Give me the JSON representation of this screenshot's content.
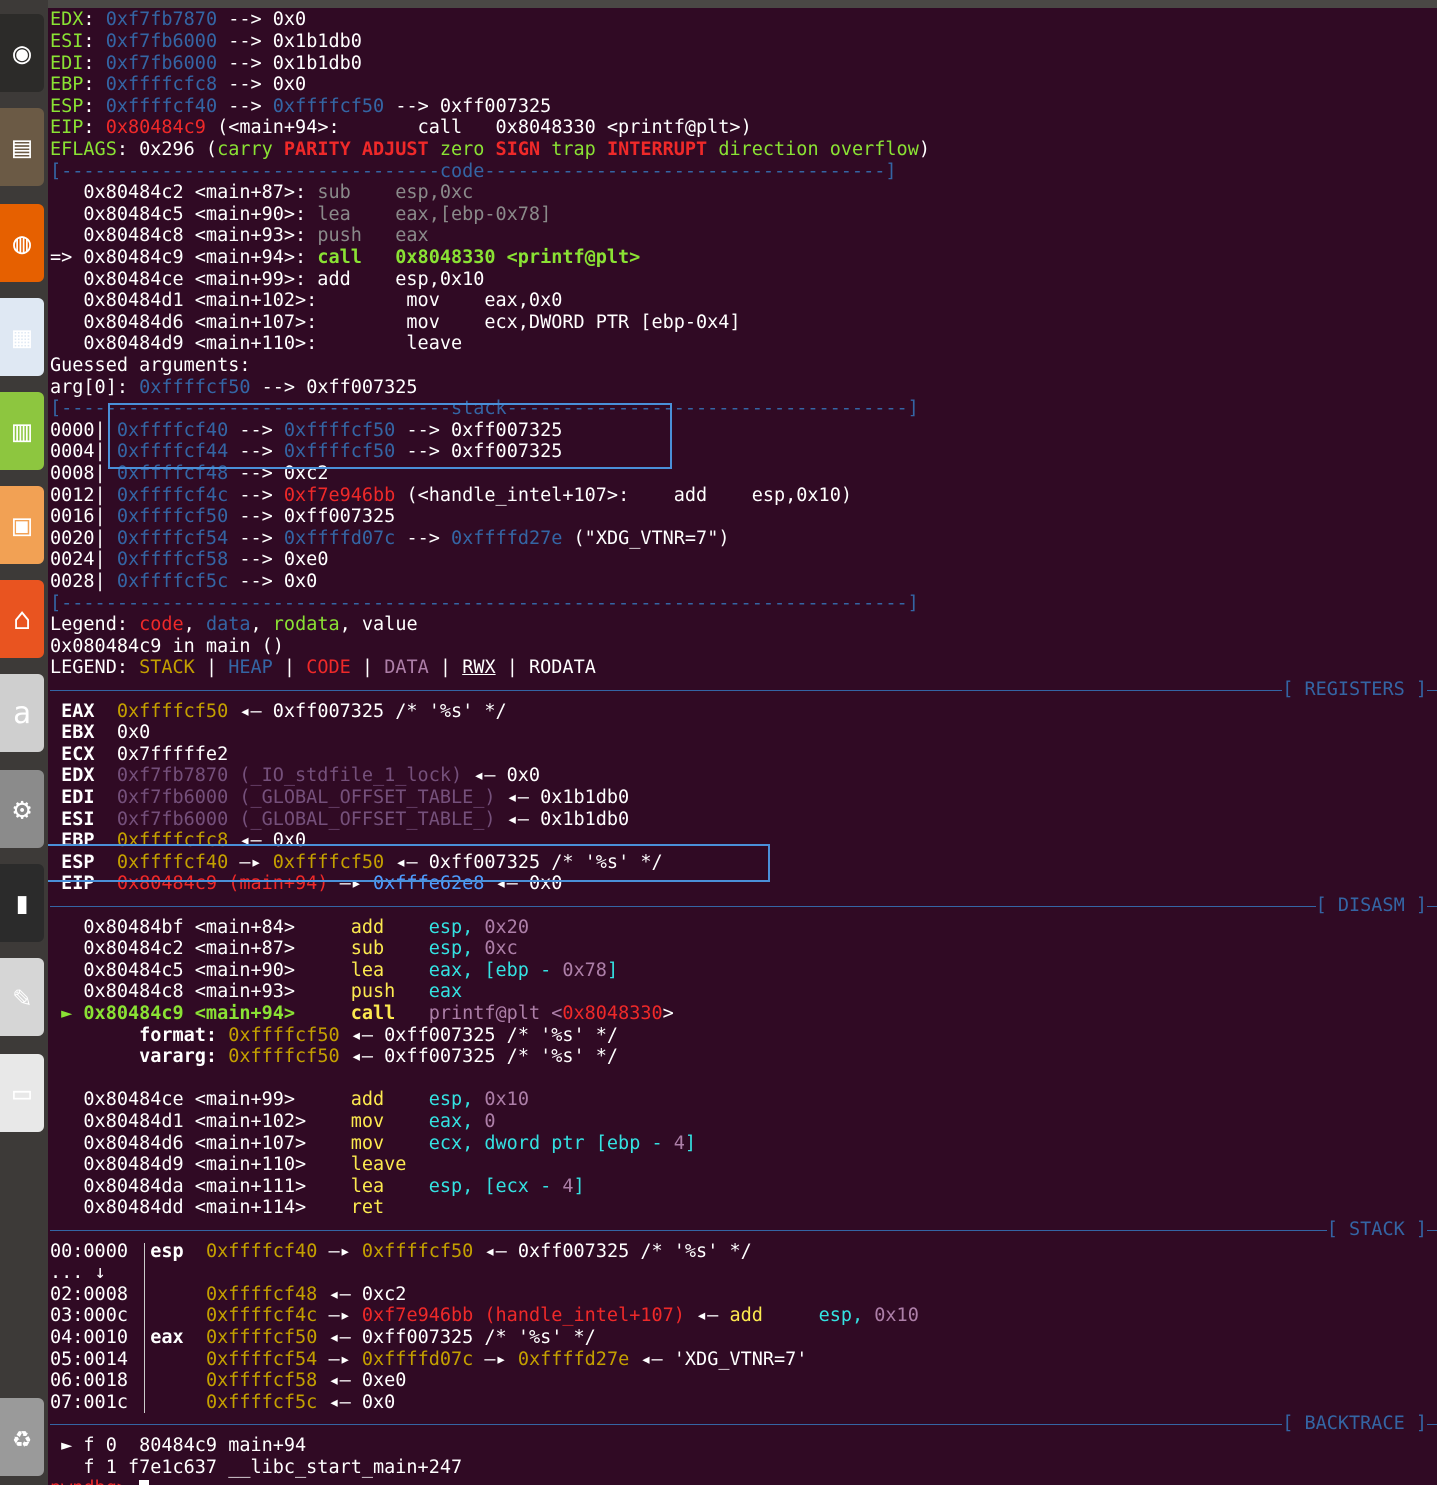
{
  "launcher": [
    {
      "name": "ubuntu-dash-icon",
      "glyph": "◉",
      "bg": "#2c2b29"
    },
    {
      "name": "files-icon",
      "glyph": "▤",
      "bg": "#6b5a45"
    },
    {
      "name": "firefox-icon",
      "glyph": "◍",
      "bg": "#e66000"
    },
    {
      "name": "writer-icon",
      "glyph": "▦",
      "bg": "#dfe8f3"
    },
    {
      "name": "calc-icon",
      "glyph": "▥",
      "bg": "#8dc63f"
    },
    {
      "name": "impress-icon",
      "glyph": "▣",
      "bg": "#f2a154"
    },
    {
      "name": "software-center-icon",
      "glyph": "⌂",
      "bg": "#e95420"
    },
    {
      "name": "amazon-icon",
      "glyph": "a",
      "bg": "#cfcfcf"
    },
    {
      "name": "settings-icon",
      "glyph": "⚙",
      "bg": "#8b8b8b"
    },
    {
      "name": "terminal-icon",
      "glyph": "▮",
      "bg": "#2b2b2b"
    },
    {
      "name": "text-editor-icon",
      "glyph": "✎",
      "bg": "#d6d6d6"
    },
    {
      "name": "save-disk-icon",
      "glyph": "▭",
      "bg": "#e8e8e8"
    },
    {
      "name": "trash-icon",
      "glyph": "♻",
      "bg": "#9a9a9a"
    }
  ],
  "colors": {
    "bg": "#300a24",
    "accent": "#3465a4",
    "highlight_box": "#4a90d9"
  },
  "peda": {
    "regs": [
      [
        [
          "EDX",
          "g"
        ],
        [
          ": ",
          "w"
        ],
        [
          "0xf7fb7870",
          "bl"
        ],
        [
          " --> 0x0",
          "w"
        ]
      ],
      [
        [
          "ESI",
          "g"
        ],
        [
          ": ",
          "w"
        ],
        [
          "0xf7fb6000",
          "bl"
        ],
        [
          " --> 0x1b1db0",
          "w"
        ]
      ],
      [
        [
          "EDI",
          "g"
        ],
        [
          ": ",
          "w"
        ],
        [
          "0xf7fb6000",
          "bl"
        ],
        [
          " --> 0x1b1db0",
          "w"
        ]
      ],
      [
        [
          "EBP",
          "g"
        ],
        [
          ": ",
          "w"
        ],
        [
          "0xffffcfc8",
          "bl"
        ],
        [
          " --> 0x0",
          "w"
        ]
      ],
      [
        [
          "ESP",
          "g"
        ],
        [
          ": ",
          "w"
        ],
        [
          "0xffffcf40",
          "bl"
        ],
        [
          " --> ",
          "w"
        ],
        [
          "0xffffcf50",
          "bl"
        ],
        [
          " --> 0xff007325",
          "w"
        ]
      ],
      [
        [
          "EIP",
          "g"
        ],
        [
          ": ",
          "w"
        ],
        [
          "0x80484c9",
          "r"
        ],
        [
          " (<main+94>:       call   0x8048330 <printf@plt>)",
          "w"
        ]
      ],
      [
        [
          "EFLAGS",
          "g"
        ],
        [
          ": 0x296 (",
          "w"
        ],
        [
          "carry ",
          "g"
        ],
        [
          "PARITY ADJUST ",
          "rb"
        ],
        [
          "zero ",
          "g"
        ],
        [
          "SIGN ",
          "rb"
        ],
        [
          "trap ",
          "g"
        ],
        [
          "INTERRUPT ",
          "rb"
        ],
        [
          "direction overflow",
          "g"
        ],
        [
          ")",
          "w"
        ]
      ]
    ],
    "code_title": "[----------------------------------code------------------------------------]",
    "code": [
      [
        [
          "   0x80484c2 <main+87>: ",
          "w"
        ],
        [
          "sub    esp,0xc",
          "gr"
        ]
      ],
      [
        [
          "   0x80484c5 <main+90>: ",
          "w"
        ],
        [
          "lea    eax,[ebp-0x78]",
          "gr"
        ]
      ],
      [
        [
          "   0x80484c8 <main+93>: ",
          "w"
        ],
        [
          "push   eax",
          "gr"
        ]
      ],
      [
        [
          "=> 0x80484c9 <main+94>: ",
          "w"
        ],
        [
          "call   0x8048330 <printf@plt>",
          "gb"
        ]
      ],
      [
        [
          "   0x80484ce <main+99>: add    esp,0x10",
          "w"
        ]
      ],
      [
        [
          "   0x80484d1 <main+102>:        mov    eax,0x0",
          "w"
        ]
      ],
      [
        [
          "   0x80484d6 <main+107>:        mov    ecx,DWORD PTR [ebp-0x4]",
          "w"
        ]
      ],
      [
        [
          "   0x80484d9 <main+110>:        leave",
          "w"
        ]
      ],
      [
        [
          "Guessed arguments:",
          "w"
        ]
      ],
      [
        [
          "arg[0]: ",
          "w"
        ],
        [
          "0xffffcf50",
          "bl"
        ],
        [
          " --> 0xff007325",
          "w"
        ]
      ]
    ],
    "stack_title": "[-----------------------------------stack------------------------------------]",
    "stack": [
      [
        [
          "0000| ",
          "w"
        ],
        [
          "0xffffcf40",
          "bl"
        ],
        [
          " --> ",
          "w"
        ],
        [
          "0xffffcf50",
          "bl"
        ],
        [
          " --> 0xff007325",
          "w"
        ]
      ],
      [
        [
          "0004| ",
          "w"
        ],
        [
          "0xffffcf44",
          "bl"
        ],
        [
          " --> ",
          "w"
        ],
        [
          "0xffffcf50",
          "bl"
        ],
        [
          " --> 0xff007325",
          "w"
        ]
      ],
      [
        [
          "0008| ",
          "w"
        ],
        [
          "0xffffcf48",
          "bl"
        ],
        [
          " --> 0xc2",
          "w"
        ]
      ],
      [
        [
          "0012| ",
          "w"
        ],
        [
          "0xffffcf4c",
          "bl"
        ],
        [
          " --> ",
          "w"
        ],
        [
          "0xf7e946bb",
          "r"
        ],
        [
          " (<handle_intel+107>:    add    esp,0x10)",
          "w"
        ]
      ],
      [
        [
          "0016| ",
          "w"
        ],
        [
          "0xffffcf50",
          "bl"
        ],
        [
          " --> 0xff007325",
          "w"
        ]
      ],
      [
        [
          "0020| ",
          "w"
        ],
        [
          "0xffffcf54",
          "bl"
        ],
        [
          " --> ",
          "w"
        ],
        [
          "0xffffd07c",
          "bl"
        ],
        [
          " --> ",
          "w"
        ],
        [
          "0xffffd27e",
          "bl"
        ],
        [
          " (\"XDG_VTNR=7\")",
          "w"
        ]
      ],
      [
        [
          "0024| ",
          "w"
        ],
        [
          "0xffffcf58",
          "bl"
        ],
        [
          " --> 0xe0",
          "w"
        ]
      ],
      [
        [
          "0028| ",
          "w"
        ],
        [
          "0xffffcf5c",
          "bl"
        ],
        [
          " --> 0x0",
          "w"
        ]
      ]
    ],
    "end_title": "[----------------------------------------------------------------------------]",
    "legend": [
      [
        [
          "Legend: ",
          "w"
        ],
        [
          "code",
          "r"
        ],
        [
          ", ",
          "w"
        ],
        [
          "data",
          "bl"
        ],
        [
          ", ",
          "w"
        ],
        [
          "rodata",
          "g"
        ],
        [
          ", value",
          "w"
        ]
      ],
      [
        [
          "0x080484c9 in main ()",
          "w"
        ]
      ],
      [
        [
          "LEGEND: ",
          "w"
        ],
        [
          "STACK",
          "yo"
        ],
        [
          " | ",
          "w"
        ],
        [
          "HEAP",
          "bl"
        ],
        [
          " | ",
          "w"
        ],
        [
          "CODE",
          "r"
        ],
        [
          " | ",
          "w"
        ],
        [
          "DATA",
          "pu"
        ],
        [
          " | ",
          "w"
        ],
        [
          "RWX",
          "wu"
        ],
        [
          " | RODATA",
          "w"
        ]
      ]
    ]
  },
  "pwndbg": {
    "registers_title": "[ REGISTERS ]",
    "registers": [
      [
        [
          " EAX  ",
          "wb"
        ],
        [
          "0xffffcf50",
          "yo"
        ],
        [
          " ◂— 0xff007325 /* '%s' */",
          "w"
        ]
      ],
      [
        [
          " EBX  ",
          "wb"
        ],
        [
          "0x0",
          "w"
        ]
      ],
      [
        [
          " ECX  ",
          "wb"
        ],
        [
          "0x7fffffe2",
          "w"
        ]
      ],
      [
        [
          " EDX  ",
          "wb"
        ],
        [
          "0xf7fb7870 (_IO_stdfile_1_lock)",
          "dim"
        ],
        [
          " ◂— 0x0",
          "w"
        ]
      ],
      [
        [
          " EDI  ",
          "wb"
        ],
        [
          "0xf7fb6000 (_GLOBAL_OFFSET_TABLE_)",
          "dim"
        ],
        [
          " ◂— 0x1b1db0",
          "w"
        ]
      ],
      [
        [
          " ESI  ",
          "wb"
        ],
        [
          "0xf7fb6000 (_GLOBAL_OFFSET_TABLE_)",
          "dim"
        ],
        [
          " ◂— 0x1b1db0",
          "w"
        ]
      ],
      [
        [
          " EBP  ",
          "wb"
        ],
        [
          "0xffffcfc8",
          "yo"
        ],
        [
          " ◂— 0x0",
          "w"
        ]
      ],
      [
        [
          " ESP  ",
          "wb"
        ],
        [
          "0xffffcf40",
          "yo"
        ],
        [
          " —▸ ",
          "w"
        ],
        [
          "0xffffcf50",
          "yo"
        ],
        [
          " ◂— 0xff007325 /* '%s' */",
          "w"
        ]
      ],
      [
        [
          " EIP  ",
          "wb"
        ],
        [
          "0x80484c9 (main+94)",
          "r"
        ],
        [
          " —▸ ",
          "w"
        ],
        [
          "0xfffe62e8",
          "lb"
        ],
        [
          " ◂— 0x0",
          "w"
        ]
      ]
    ],
    "disasm_title": "[ DISASM ]",
    "disasm": [
      [
        [
          "   0x80484bf <main+84>     ",
          "w"
        ],
        [
          "add",
          "y"
        ],
        [
          "    esp, ",
          "cy"
        ],
        [
          "0x20",
          "pu"
        ]
      ],
      [
        [
          "   0x80484c2 <main+87>     ",
          "w"
        ],
        [
          "sub",
          "y"
        ],
        [
          "    esp, ",
          "cy"
        ],
        [
          "0xc",
          "pu"
        ]
      ],
      [
        [
          "   0x80484c5 <main+90>     ",
          "w"
        ],
        [
          "lea",
          "y"
        ],
        [
          "    eax, [ebp - ",
          "cy"
        ],
        [
          "0x78",
          "pu"
        ],
        [
          "]",
          "cy"
        ]
      ],
      [
        [
          "   0x80484c8 <main+93>     ",
          "w"
        ],
        [
          "push",
          "y"
        ],
        [
          "   eax",
          "cy"
        ]
      ],
      [
        [
          " ► 0x80484c9 <main+94>     ",
          "gb"
        ],
        [
          "call",
          "yb"
        ],
        [
          "   printf@plt <",
          "pu"
        ],
        [
          "0x8048330",
          "r"
        ],
        [
          ">",
          "w"
        ]
      ],
      [
        [
          "        format: ",
          "wb"
        ],
        [
          "0xffffcf50",
          "yo"
        ],
        [
          " ◂— 0xff007325 /* '%s' */",
          "w"
        ]
      ],
      [
        [
          "        vararg: ",
          "wb"
        ],
        [
          "0xffffcf50",
          "yo"
        ],
        [
          " ◂— 0xff007325 /* '%s' */",
          "w"
        ]
      ],
      [
        [
          "",
          "w"
        ]
      ],
      [
        [
          "   0x80484ce <main+99>     ",
          "w"
        ],
        [
          "add",
          "y"
        ],
        [
          "    esp, ",
          "cy"
        ],
        [
          "0x10",
          "pu"
        ]
      ],
      [
        [
          "   0x80484d1 <main+102>    ",
          "w"
        ],
        [
          "mov",
          "y"
        ],
        [
          "    eax, ",
          "cy"
        ],
        [
          "0",
          "pu"
        ]
      ],
      [
        [
          "   0x80484d6 <main+107>    ",
          "w"
        ],
        [
          "mov",
          "y"
        ],
        [
          "    ecx, dword ptr [ebp - ",
          "cy"
        ],
        [
          "4",
          "pu"
        ],
        [
          "]",
          "cy"
        ]
      ],
      [
        [
          "   0x80484d9 <main+110>    ",
          "w"
        ],
        [
          "leave",
          "y"
        ]
      ],
      [
        [
          "   0x80484da <main+111>    ",
          "w"
        ],
        [
          "lea",
          "y"
        ],
        [
          "    esp, [ecx - ",
          "cy"
        ],
        [
          "4",
          "pu"
        ],
        [
          "]",
          "cy"
        ]
      ],
      [
        [
          "   0x80484dd <main+114>    ",
          "w"
        ],
        [
          "ret",
          "y"
        ]
      ]
    ],
    "stack_title": "[ STACK ]",
    "stack": [
      [
        [
          "00:0000  ",
          "w"
        ],
        [
          "esp  ",
          "wb"
        ],
        [
          "0xffffcf40",
          "yo"
        ],
        [
          " —▸ ",
          "w"
        ],
        [
          "0xffffcf50",
          "yo"
        ],
        [
          " ◂— 0xff007325 /* '%s' */",
          "w"
        ]
      ],
      [
        [
          "... ↓",
          "w"
        ]
      ],
      [
        [
          "02:0008       ",
          "w"
        ],
        [
          "0xffffcf48",
          "yo"
        ],
        [
          " ◂— 0xc2",
          "w"
        ]
      ],
      [
        [
          "03:000c       ",
          "w"
        ],
        [
          "0xffffcf4c",
          "yo"
        ],
        [
          " —▸ ",
          "w"
        ],
        [
          "0xf7e946bb (handle_intel+107)",
          "r"
        ],
        [
          " ◂— ",
          "w"
        ],
        [
          "add",
          "y"
        ],
        [
          "     esp, ",
          "cy"
        ],
        [
          "0x10",
          "pu"
        ]
      ],
      [
        [
          "04:0010  ",
          "w"
        ],
        [
          "eax  ",
          "wb"
        ],
        [
          "0xffffcf50",
          "yo"
        ],
        [
          " ◂— 0xff007325 /* '%s' */",
          "w"
        ]
      ],
      [
        [
          "05:0014       ",
          "w"
        ],
        [
          "0xffffcf54",
          "yo"
        ],
        [
          " —▸ ",
          "w"
        ],
        [
          "0xffffd07c",
          "yo"
        ],
        [
          " —▸ ",
          "w"
        ],
        [
          "0xffffd27e",
          "yo"
        ],
        [
          " ◂— 'XDG_VTNR=7'",
          "w"
        ]
      ],
      [
        [
          "06:0018       ",
          "w"
        ],
        [
          "0xffffcf58",
          "yo"
        ],
        [
          " ◂— 0xe0",
          "w"
        ]
      ],
      [
        [
          "07:001c       ",
          "w"
        ],
        [
          "0xffffcf5c",
          "yo"
        ],
        [
          " ◂— 0x0",
          "w"
        ]
      ]
    ],
    "backtrace_title": "[ BACKTRACE ]",
    "backtrace": [
      [
        [
          " ► f 0  80484c9 main+94",
          "w"
        ]
      ],
      [
        [
          "   f 1 f7e1c637 __libc_start_main+247",
          "w"
        ]
      ]
    ],
    "prompt": "pwndbg> "
  }
}
